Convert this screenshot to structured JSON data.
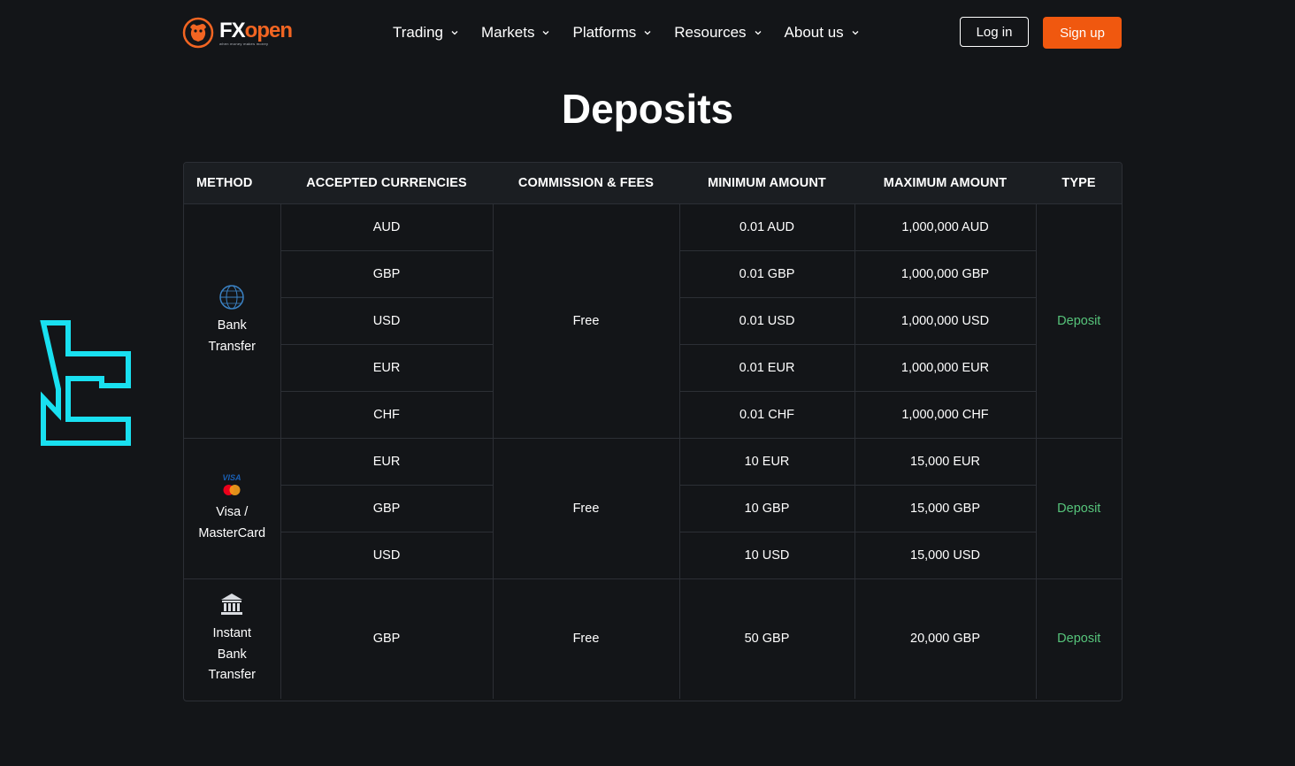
{
  "brand": {
    "word_fx": "FX",
    "word_open": "open",
    "tagline": "when money makes money"
  },
  "nav": {
    "items": [
      {
        "label": "Trading",
        "icon": "chevron-down-icon"
      },
      {
        "label": "Markets",
        "icon": "chevron-down-icon"
      },
      {
        "label": "Platforms",
        "icon": "chevron-down-icon"
      },
      {
        "label": "Resources",
        "icon": "chevron-down-icon"
      },
      {
        "label": "About us",
        "icon": "chevron-down-icon"
      }
    ],
    "login_label": "Log in",
    "signup_label": "Sign up"
  },
  "page": {
    "title": "Deposits"
  },
  "table": {
    "headers": {
      "method": "METHOD",
      "currencies": "ACCEPTED CURRENCIES",
      "fees": "COMMISSION & FEES",
      "min": "MINIMUM AMOUNT",
      "max": "MAXIMUM AMOUNT",
      "type": "TYPE"
    },
    "groups": [
      {
        "method_lines": [
          "Bank",
          "Transfer"
        ],
        "icon": "globe-swift-icon",
        "fees": "Free",
        "type": "Deposit",
        "rows": [
          {
            "currency": "AUD",
            "min": "0.01 AUD",
            "max": "1,000,000 AUD"
          },
          {
            "currency": "GBP",
            "min": "0.01 GBP",
            "max": "1,000,000 GBP"
          },
          {
            "currency": "USD",
            "min": "0.01 USD",
            "max": "1,000,000 USD"
          },
          {
            "currency": "EUR",
            "min": "0.01 EUR",
            "max": "1,000,000 EUR"
          },
          {
            "currency": "CHF",
            "min": "0.01 CHF",
            "max": "1,000,000 CHF"
          }
        ]
      },
      {
        "method_lines": [
          "Visa /",
          "MasterCard"
        ],
        "icon": "visa-mastercard-icon",
        "icon_text": "VISA",
        "fees": "Free",
        "type": "Deposit",
        "rows": [
          {
            "currency": "EUR",
            "min": "10 EUR",
            "max": "15,000 EUR"
          },
          {
            "currency": "GBP",
            "min": "10 GBP",
            "max": "15,000 GBP"
          },
          {
            "currency": "USD",
            "min": "10 USD",
            "max": "15,000 USD"
          }
        ]
      },
      {
        "method_lines": [
          "Instant",
          "Bank",
          "Transfer"
        ],
        "icon": "bank-building-icon",
        "fees": "Free",
        "type": "Deposit",
        "rows": [
          {
            "currency": "GBP",
            "min": "50 GBP",
            "max": "20,000 GBP"
          }
        ]
      }
    ]
  },
  "colors": {
    "background": "#131518",
    "accent_orange": "#f0580f",
    "deposit_green": "#56c37a",
    "badge_cyan": "#19e0f0"
  }
}
